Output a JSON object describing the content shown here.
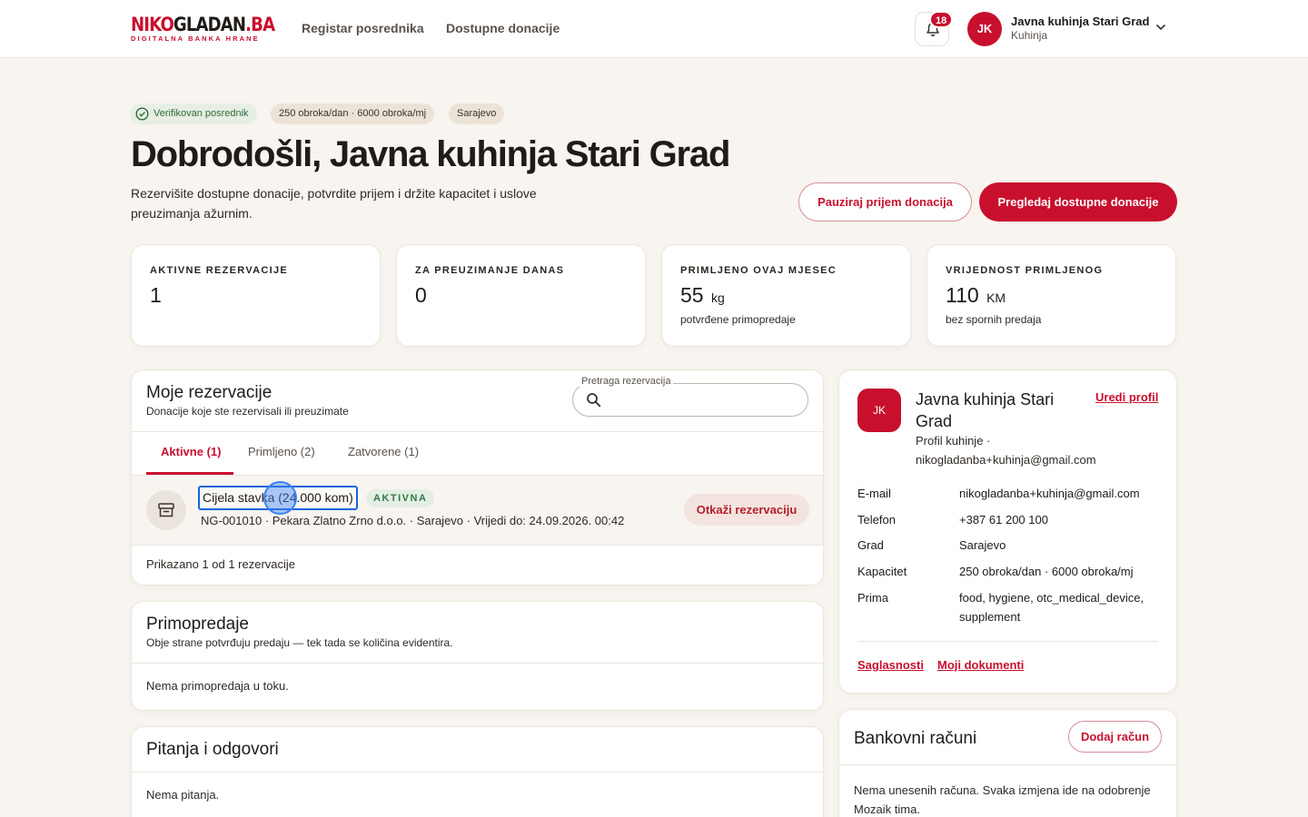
{
  "header": {
    "logo_main_left": "NIKO",
    "logo_main_mid": "GLADAN",
    "logo_main_right": ".BA",
    "logo_sub": "DIGITALNA BANKA HRANE",
    "nav": [
      "Registar posrednika",
      "Dostupne donacije"
    ],
    "notification_count": "18",
    "user_initials": "JK",
    "user_name": "Javna kuhinja Stari Grad",
    "user_role": "Kuhinja"
  },
  "hero": {
    "pills": [
      "Verifikovan posrednik",
      "250 obroka/dan · 6000 obroka/mj",
      "Sarajevo"
    ],
    "title": "Dobrodošli, Javna kuhinja Stari Grad",
    "subtitle": "Rezervišite dostupne donacije, potvrdite prijem i držite kapacitet i uslove preuzimanja ažurnim.",
    "pause_button": "Pauziraj prijem donacija",
    "browse_button": "Pregledaj dostupne donacije"
  },
  "stats": [
    {
      "label": "AKTIVNE REZERVACIJE",
      "value": "1",
      "unit": "",
      "note": ""
    },
    {
      "label": "ZA PREUZIMANJE DANAS",
      "value": "0",
      "unit": "",
      "note": ""
    },
    {
      "label": "PRIMLJENO OVAJ MJESEC",
      "value": "55",
      "unit": "kg",
      "note": "potvrđene primopredaje"
    },
    {
      "label": "VRIJEDNOST PRIMLJENOG",
      "value": "110",
      "unit": "KM",
      "note": "bez spornih predaja"
    }
  ],
  "reservations": {
    "title": "Moje rezervacije",
    "subtitle": "Donacije koje ste rezervisali ili preuzimate",
    "search_label": "Pretraga rezervacija",
    "search_value": "",
    "tabs": [
      "Aktivne (1)",
      "Primljeno (2)",
      "Zatvorene (1)"
    ],
    "items": [
      {
        "title": "Cijela stavka (24.000 kom)",
        "status": "AKTIVNA",
        "meta": "NG-001010 · Pekara Zlatno Zrno d.o.o. · Sarajevo · Vrijedi do: 24.09.2026. 00:42",
        "cancel_label": "Otkaži rezervaciju"
      }
    ],
    "footer": "Prikazano 1 od 1 rezervacije"
  },
  "handovers": {
    "title": "Primopredaje",
    "subtitle": "Obje strane potvrđuju predaju — tek tada se količina evidentira.",
    "empty": "Nema primopredaja u toku."
  },
  "qa": {
    "title": "Pitanja i odgovori",
    "empty": "Nema pitanja."
  },
  "profile": {
    "initials": "JK",
    "name": "Javna kuhinja Stari Grad",
    "edit_label": "Uredi profil",
    "meta": "Profil kuhinje · nikogladanba+kuhinja@gmail.com",
    "fields": [
      {
        "label": "E-mail",
        "value": "nikogladanba+kuhinja@gmail.com"
      },
      {
        "label": "Telefon",
        "value": "+387 61 200 100"
      },
      {
        "label": "Grad",
        "value": "Sarajevo"
      },
      {
        "label": "Kapacitet",
        "value": "250 obroka/dan · 6000 obroka/mj"
      },
      {
        "label": "Prima",
        "value": "food, hygiene, otc_medical_device, supplement"
      }
    ],
    "links": [
      "Saglasnosti",
      "Moji dokumenti"
    ]
  },
  "bank": {
    "title": "Bankovni računi",
    "add_label": "Dodaj račun",
    "empty": "Nema unesenih računa. Svaka izmjena ide na odobrenje Mozaik tima."
  },
  "colors": {
    "brand": "#c8102e",
    "background": "#f8f4ef",
    "success": "#2f7a45",
    "focus": "#1565e0"
  }
}
